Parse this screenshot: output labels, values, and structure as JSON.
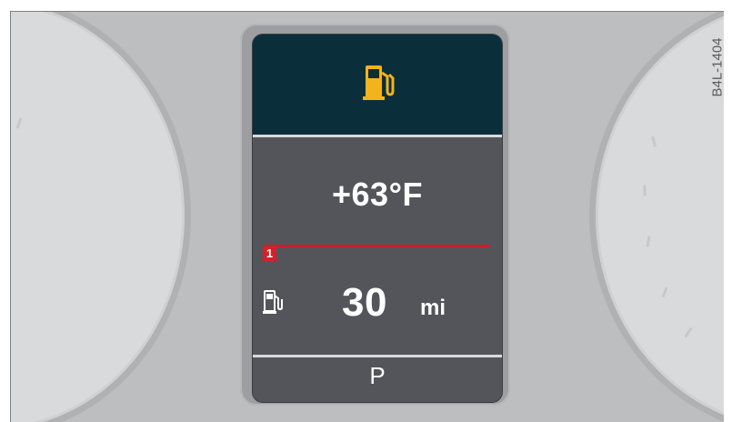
{
  "display": {
    "temperature": "+63°F",
    "marker_label": "1",
    "range_value": "30",
    "range_unit": "mi",
    "gear": "P"
  },
  "figure_code": "B4L-1404",
  "icons": {
    "warning": "fuel-pump-warning-icon",
    "range": "fuel-pump-icon"
  },
  "colors": {
    "warning_icon": "#f2b31c",
    "screen_top": "#0a2f3b",
    "screen_body": "#53555a",
    "marker_red": "#d3212b",
    "text": "#ffffff"
  }
}
